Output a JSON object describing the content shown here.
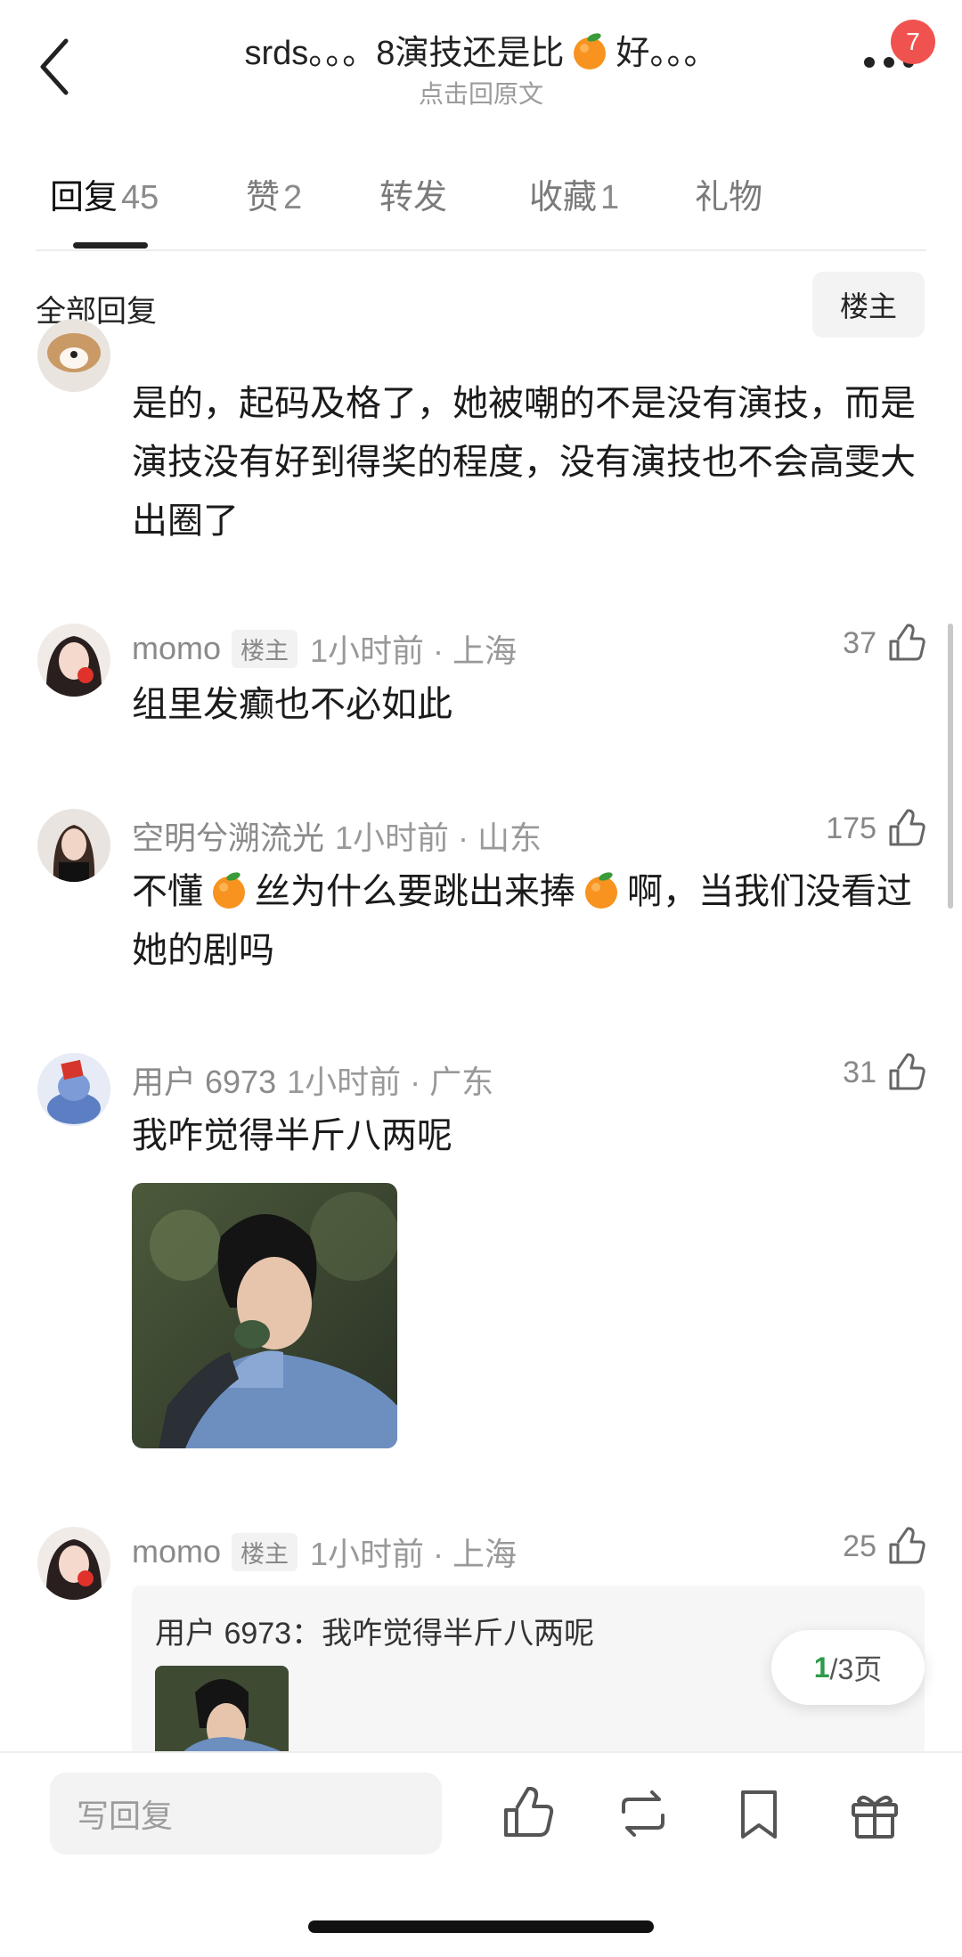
{
  "header": {
    "title_part1": "srds。。。8演技还是比",
    "title_part2": "好。。。",
    "subtitle": "点击回原文",
    "notification_count": "7"
  },
  "tabs": [
    {
      "label": "回复",
      "count": "45"
    },
    {
      "label": "赞",
      "count": "2"
    },
    {
      "label": "转发",
      "count": ""
    },
    {
      "label": "收藏",
      "count": "1"
    },
    {
      "label": "礼物",
      "count": ""
    }
  ],
  "filter": {
    "label": "全部回复",
    "button": "楼主"
  },
  "comments": [
    {
      "text": "是的，起码及格了，她被嘲的不是没有演技，而是演技没有好到得奖的程度，没有演技也不会高雯大出圈了"
    },
    {
      "name": "momo",
      "tag": "楼主",
      "time": "1小时前 · 上海",
      "likes": "37",
      "text": "组里发癫也不必如此"
    },
    {
      "name": "空明兮溯流光",
      "time": "1小时前 · 山东",
      "likes": "175",
      "text_part1": "不懂",
      "text_part2": "丝为什么要跳出来捧",
      "text_part3": "啊，当我们没看过她的剧吗"
    },
    {
      "name": "用户 6973",
      "time": "1小时前 · 广东",
      "likes": "31",
      "text": "我咋觉得半斤八两呢"
    },
    {
      "name": "momo",
      "tag": "楼主",
      "time": "1小时前 · 上海",
      "likes": "25",
      "quote": "用户 6973：我咋觉得半斤八两呢"
    }
  ],
  "pagination": {
    "current": "1",
    "total": "/3页"
  },
  "bottom_bar": {
    "placeholder": "写回复"
  },
  "colors": {
    "badge": "#f0534f",
    "page_current": "#2f9a4a"
  }
}
